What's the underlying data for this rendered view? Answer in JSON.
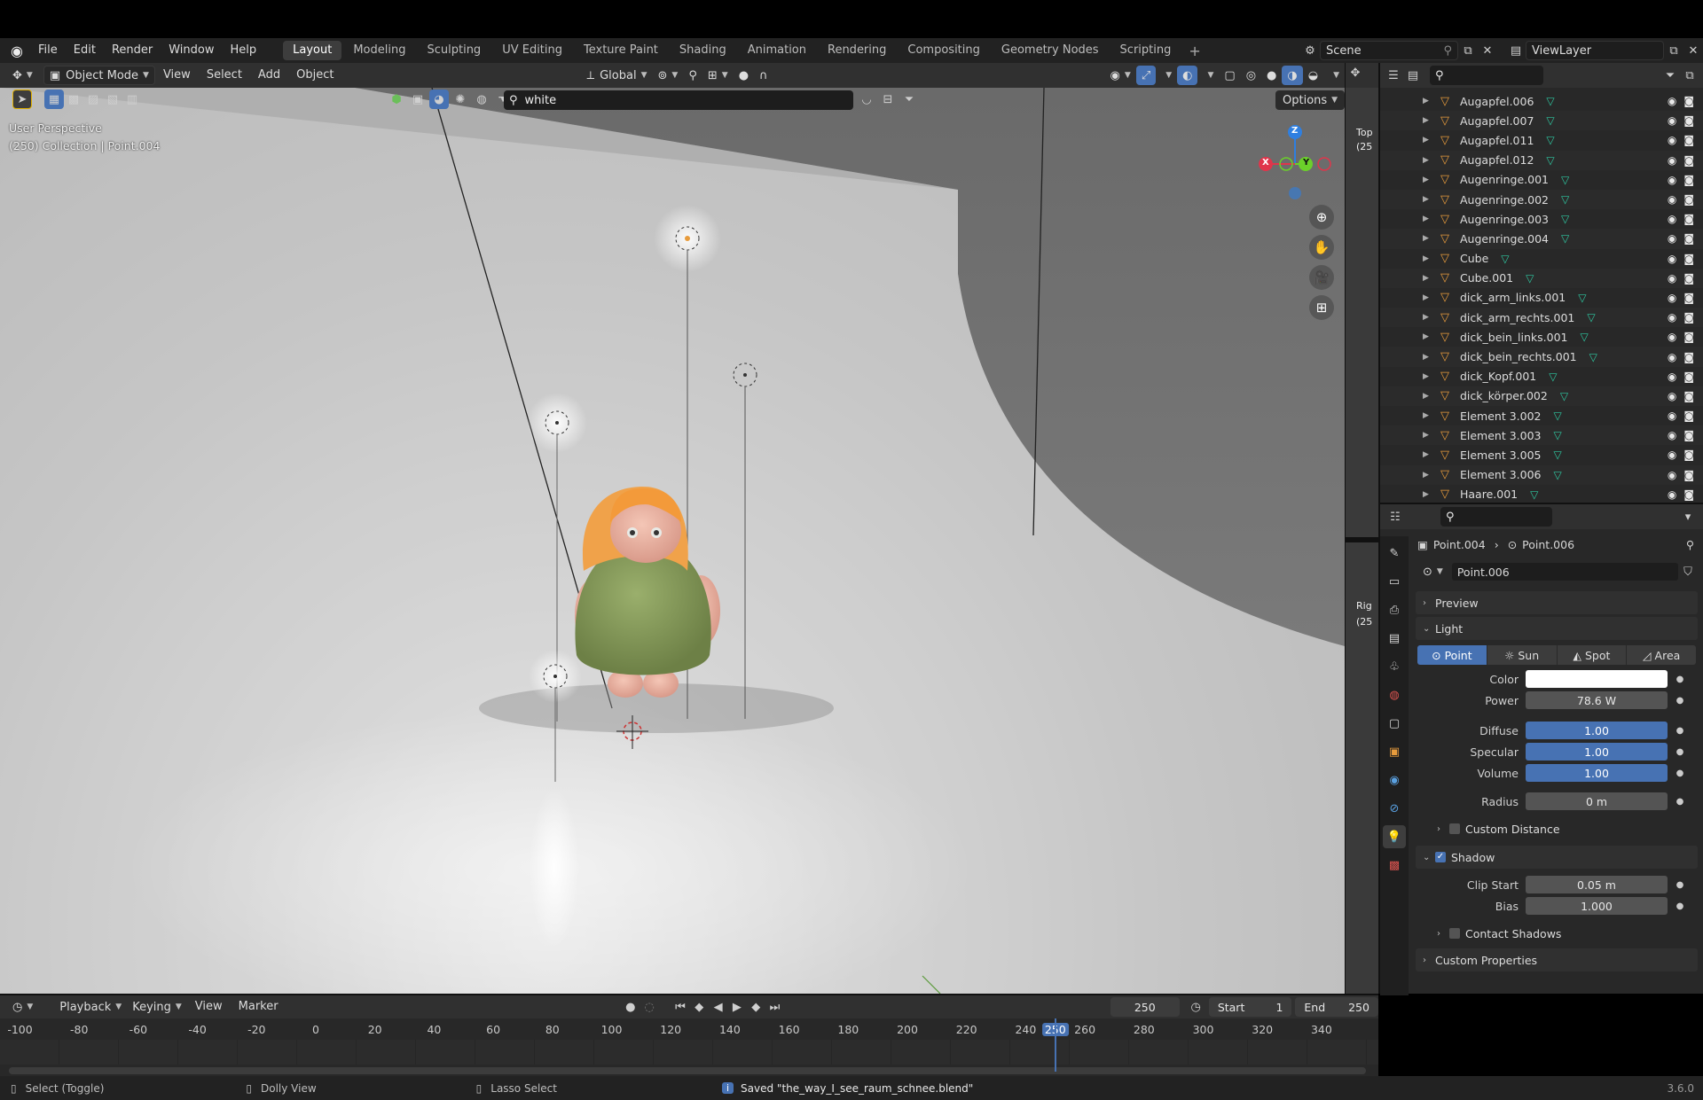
{
  "app": {
    "version": "3.6.0"
  },
  "menu": {
    "items": [
      "File",
      "Edit",
      "Render",
      "Window",
      "Help"
    ]
  },
  "workspaces": {
    "tabs": [
      "Layout",
      "Modeling",
      "Sculpting",
      "UV Editing",
      "Texture Paint",
      "Shading",
      "Animation",
      "Rendering",
      "Compositing",
      "Geometry Nodes",
      "Scripting"
    ],
    "active": "Layout"
  },
  "scene": {
    "name": "Scene",
    "view_layer": "ViewLayer"
  },
  "viewport_header": {
    "mode": "Object Mode",
    "menus": [
      "View",
      "Select",
      "Add",
      "Object"
    ],
    "transform_orientation": "Global"
  },
  "viewport_tools": {
    "search_value": "white",
    "options_label": "Options"
  },
  "viewport_overlay": {
    "perspective": "User Perspective",
    "collection_info": "(250) Collection | Point.004",
    "gizmo": {
      "z": "Z",
      "y": "Y",
      "x": "X"
    }
  },
  "mini_viewport": {
    "label_top": "Top",
    "label_top2": "(25",
    "label_right": "Rig",
    "label_right2": "(25"
  },
  "outliner": {
    "items": [
      "Augapfel.006",
      "Augapfel.007",
      "Augapfel.011",
      "Augapfel.012",
      "Augenringe.001",
      "Augenringe.002",
      "Augenringe.003",
      "Augenringe.004",
      "Cube",
      "Cube.001",
      "dick_arm_links.001",
      "dick_arm_rechts.001",
      "dick_bein_links.001",
      "dick_bein_rechts.001",
      "dick_Kopf.001",
      "dick_körper.002",
      "Element 3.002",
      "Element 3.003",
      "Element 3.005",
      "Element 3.006",
      "Haare.001"
    ]
  },
  "properties": {
    "breadcrumb_object": "Point.004",
    "breadcrumb_data": "Point.006",
    "datablock_name": "Point.006",
    "panels": {
      "preview": "Preview",
      "light": "Light",
      "custom_distance": "Custom Distance",
      "shadow": "Shadow",
      "contact_shadows": "Contact Shadows",
      "custom_properties": "Custom Properties"
    },
    "light_types": [
      "Point",
      "Sun",
      "Spot",
      "Area"
    ],
    "active_light_type": "Point",
    "color_label": "Color",
    "color_value": "#ffffff",
    "power_label": "Power",
    "power_value": "78.6 W",
    "diffuse_label": "Diffuse",
    "diffuse_value": "1.00",
    "specular_label": "Specular",
    "specular_value": "1.00",
    "volume_label": "Volume",
    "volume_value": "1.00",
    "radius_label": "Radius",
    "radius_value": "0 m",
    "clip_start_label": "Clip Start",
    "clip_start_value": "0.05 m",
    "bias_label": "Bias",
    "bias_value": "1.000",
    "shadow_enabled": true
  },
  "timeline": {
    "menus": [
      "Playback",
      "Keying",
      "View",
      "Marker"
    ],
    "current_frame": "250",
    "start_label": "Start",
    "start_value": "1",
    "end_label": "End",
    "end_value": "250",
    "ruler_labels": [
      "-100",
      "-80",
      "-60",
      "-40",
      "-20",
      "0",
      "20",
      "40",
      "60",
      "80",
      "100",
      "120",
      "140",
      "160",
      "180",
      "200",
      "220",
      "240",
      "250",
      "260",
      "280",
      "300",
      "320",
      "340"
    ]
  },
  "status": {
    "hint1": "Select (Toggle)",
    "hint2": "Dolly View",
    "hint3": "Lasso Select",
    "message": "Saved \"the_way_I_see_raum_schnee.blend\""
  },
  "colors": {
    "accent": "#4772b3",
    "object_icon": "#e79b3c",
    "mesh_icon": "#2ec7a0"
  }
}
